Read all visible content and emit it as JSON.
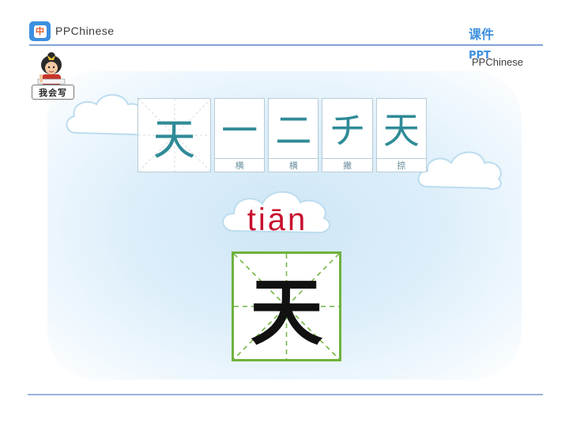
{
  "header": {
    "logo_glyph": "中",
    "brand": "PPChinese",
    "ppt_cn": "课件",
    "ppt_en": "PPT",
    "brand_right": "PPChinese"
  },
  "mascot": {
    "label": "我会写"
  },
  "stroke_order": {
    "full_char": "天",
    "steps": [
      {
        "glyph": "一",
        "name": "横"
      },
      {
        "glyph": "二",
        "name": "横"
      },
      {
        "glyph": "チ",
        "name": "撇"
      },
      {
        "glyph": "天",
        "name": "捺"
      }
    ]
  },
  "main": {
    "pinyin": "tiān",
    "character": "天"
  },
  "colors": {
    "accent_blue": "#3d8fe0",
    "pinyin_red": "#c8102e",
    "grid_green": "#6fb23c",
    "stroke_teal": "#2f8b97"
  }
}
